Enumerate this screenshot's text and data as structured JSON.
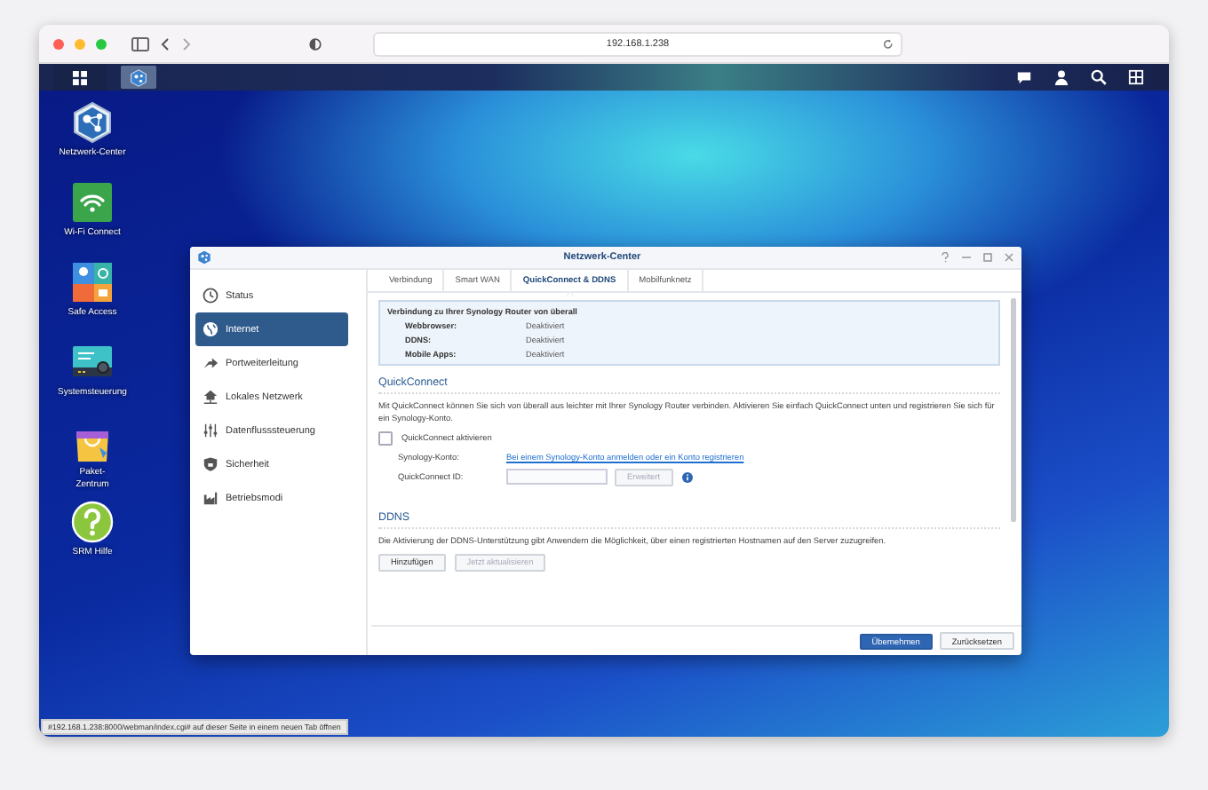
{
  "browser": {
    "address": "192.168.1.238",
    "status_link": "#192.168.1.238:8000/webman/index.cgi# auf dieser Seite in einem neuen Tab öffnen"
  },
  "taskbar": {
    "apps": [
      {
        "kind": "network",
        "selected": true
      }
    ]
  },
  "desktop_icons": [
    {
      "kind": "network",
      "label": "Netzwerk-Center"
    },
    {
      "kind": "wifi",
      "label": "Wi-Fi Connect"
    },
    {
      "kind": "safe",
      "label": "Safe Access"
    },
    {
      "kind": "system",
      "label": "Systemsteuerung"
    },
    {
      "kind": "package",
      "label": "Paket-\nZentrum"
    },
    {
      "kind": "help",
      "label": "SRM Hilfe"
    }
  ],
  "window": {
    "title": "Netzwerk-Center",
    "sidebar": {
      "items": [
        {
          "kind": "status",
          "label": "Status",
          "selected": false
        },
        {
          "kind": "internet",
          "label": "Internet",
          "selected": true
        },
        {
          "kind": "port",
          "label": "Portweiterleitung",
          "selected": false
        },
        {
          "kind": "lan",
          "label": "Lokales Netzwerk",
          "selected": false
        },
        {
          "kind": "traffic",
          "label": "Datenflusssteuerung",
          "selected": false
        },
        {
          "kind": "security",
          "label": "Sicherheit",
          "selected": false
        },
        {
          "kind": "mode",
          "label": "Betriebsmodi",
          "selected": false
        }
      ]
    },
    "tabs": [
      {
        "label": "Verbindung",
        "selected": false
      },
      {
        "label": "Smart WAN",
        "selected": false
      },
      {
        "label": "QuickConnect & DDNS",
        "selected": true
      },
      {
        "label": "Mobilfunknetz",
        "selected": false
      }
    ],
    "info_box": {
      "title": "Verbindung zu Ihrer Synology Router von überall",
      "rows": [
        {
          "label": "Webbrowser:",
          "value": "Deaktiviert"
        },
        {
          "label": "DDNS:",
          "value": "Deaktiviert"
        },
        {
          "label": "Mobile Apps:",
          "value": "Deaktiviert"
        }
      ]
    },
    "quickconnect": {
      "heading": "QuickConnect",
      "description": "Mit QuickConnect können Sie sich von überall aus leichter mit Ihrer Synology Router verbinden. Aktivieren Sie einfach QuickConnect unten und registrieren Sie sich für ein Synology-Konto.",
      "enable": {
        "label": "QuickConnect aktivieren",
        "checked": false
      },
      "account_label": "Synology-Konto:",
      "account_link": "Bei einem Synology-Konto anmelden oder ein Konto registrieren",
      "id_label": "QuickConnect ID:",
      "advanced_button": {
        "label": "Erweitert",
        "disabled": true
      }
    },
    "ddns": {
      "heading": "DDNS",
      "description": "Die Aktivierung der DDNS-Unterstützung gibt Anwendern die Möglichkeit, über einen registrierten Hostnamen auf den Server zuzugreifen.",
      "buttons": [
        {
          "label": "Hinzufügen",
          "disabled": false
        },
        {
          "label": "Jetzt aktualisieren",
          "disabled": true
        }
      ]
    },
    "footer_buttons": [
      {
        "label": "Übernehmen",
        "kind": "primary"
      },
      {
        "label": "Zurücksetzen",
        "kind": "secondary"
      }
    ]
  }
}
